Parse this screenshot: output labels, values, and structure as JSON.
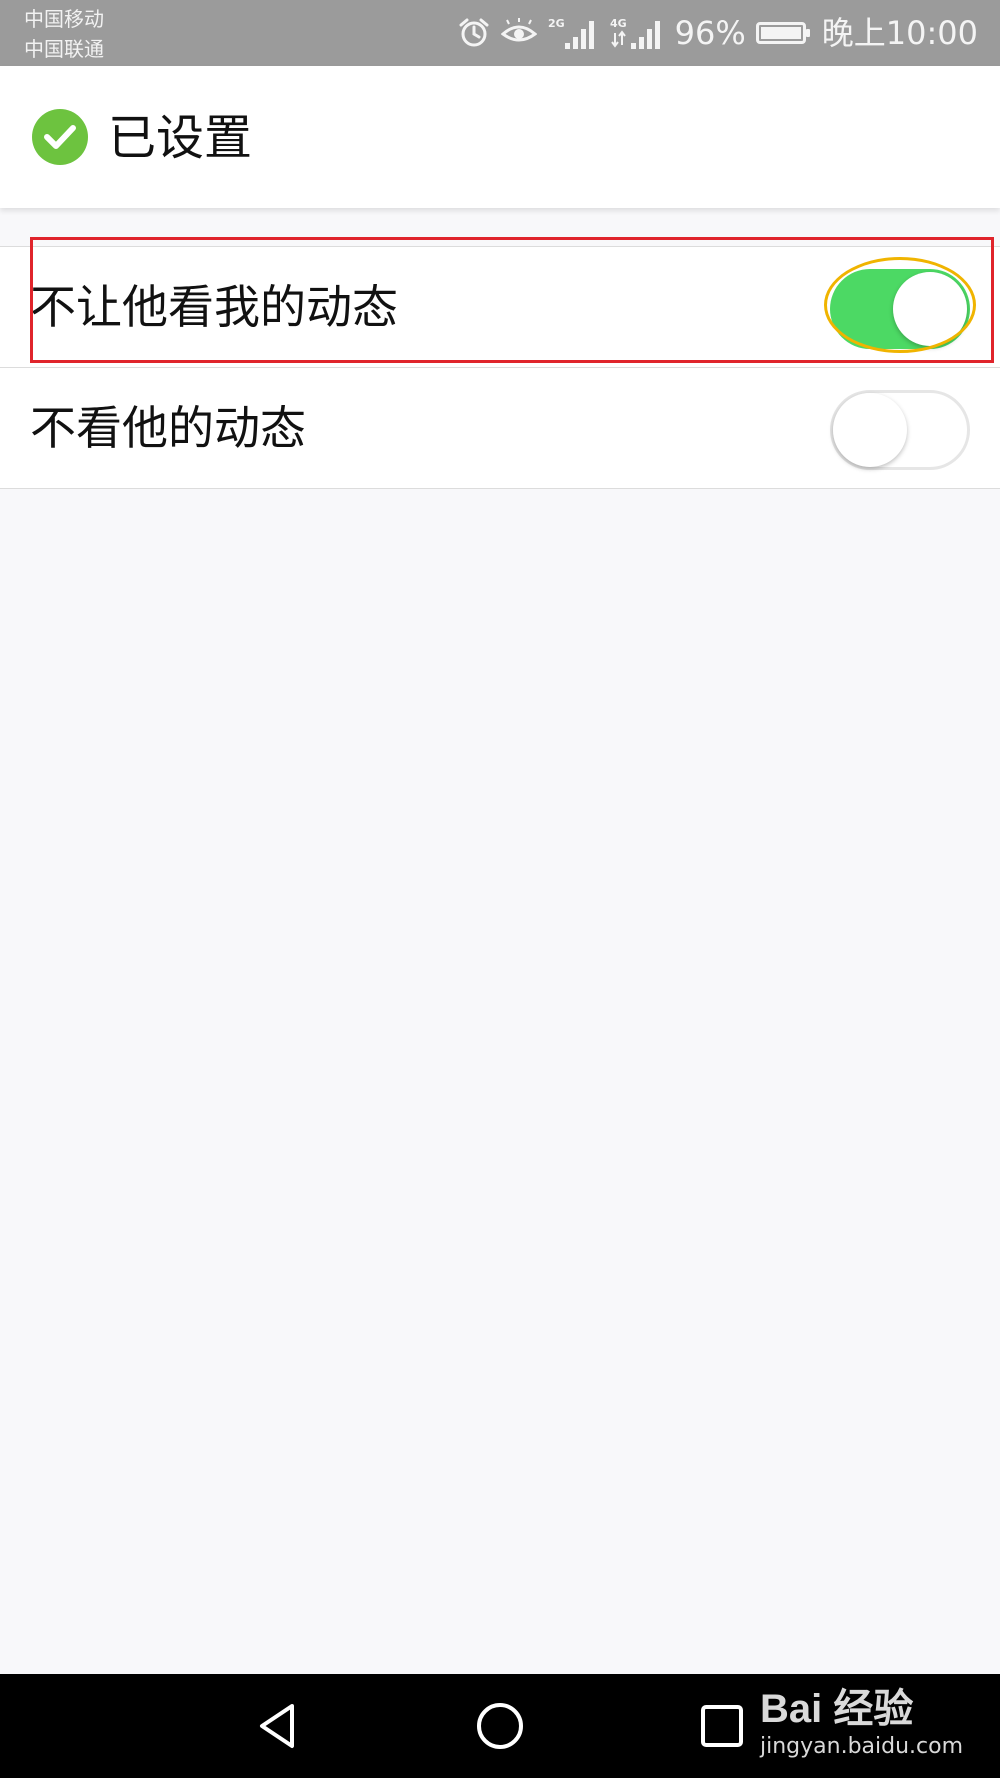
{
  "status_bar": {
    "carrier_1": "中国移动",
    "carrier_2": "中国联通",
    "net_1": "2G",
    "net_2": "4G",
    "battery": "96%",
    "time": "晚上10:00"
  },
  "header": {
    "title": "已设置",
    "icon": "check-circle-icon"
  },
  "settings": {
    "items": [
      {
        "label": "不让他看我的动态",
        "enabled": true
      },
      {
        "label": "不看他的动态",
        "enabled": false
      }
    ]
  },
  "watermark": {
    "logo": "Bai 经验",
    "url": "jingyan.baidu.com"
  },
  "colors": {
    "switch_on": "#4cd964",
    "check_green": "#6dc33f",
    "annotation_red": "#e0242b",
    "annotation_yellow": "#f0b400"
  }
}
